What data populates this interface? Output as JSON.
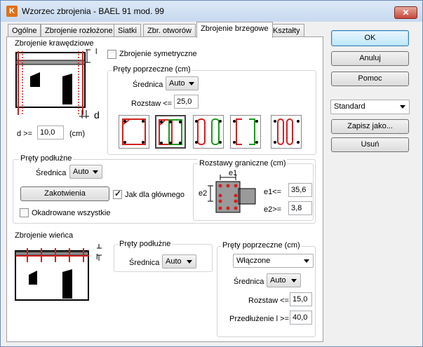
{
  "window": {
    "title": "Wzorzec zbrojenia - BAEL 91 mod. 99",
    "app_icon": "K",
    "close_symbol": "✕"
  },
  "tabs": [
    "Ogólne",
    "Zbrojenie rozłożone",
    "Siatki",
    "Zbr. otworów",
    "Zbrojenie brzegowe",
    "Kształty"
  ],
  "edge_reinf": {
    "group_title": "Zbrojenie krawędziowe",
    "symmetric_label": "Zbrojenie symetryczne",
    "symmetric_checked": false,
    "dim_l": "l",
    "dim_d": "d",
    "d_label": "d >=",
    "d_value": "10,0",
    "d_unit": "(cm)",
    "transverse": {
      "title": "Pręty poprzeczne (cm)",
      "diameter_label": "Średnica",
      "diameter_value": "Auto",
      "spacing_label": "Rozstaw <=",
      "spacing_value": "25,0",
      "selected_shape": 2
    }
  },
  "longitudinal": {
    "title": "Pręty podłużne",
    "diameter_label": "Średnica",
    "diameter_value": "Auto",
    "anchor_button": "Zakotwienia",
    "main_like_label": "Jak dla głównego",
    "main_like_checked": true,
    "framed_all_label": "Okadrowane wszystkie",
    "framed_all_checked": false
  },
  "boundary_spacing": {
    "title": "Rozstawy graniczne (cm)",
    "e1_top": "e1",
    "e2_side": "e2",
    "e1_label": "e1<=",
    "e1_value": "35,6",
    "e2_label": "e2>=",
    "e2_value": "3,8"
  },
  "ring_beam": {
    "title": "Zbrojenie wieńca",
    "dim_l": "l",
    "long_title": "Pręty podłużne",
    "long_diameter_label": "Średnica",
    "long_diameter_value": "Auto",
    "trans_title": "Pręty poprzeczne (cm)",
    "trans_mode_value": "Włączone",
    "trans_diameter_label": "Średnica",
    "trans_diameter_value": "Auto",
    "trans_spacing_label": "Rozstaw <=",
    "trans_spacing_value": "15,0",
    "extension_label": "Przedłużenie l >=",
    "extension_value": "40,0"
  },
  "side_panel": {
    "ok": "OK",
    "cancel": "Anuluj",
    "help": "Pomoc",
    "preset_value": "Standard",
    "save_as": "Zapisz jako...",
    "delete": "Usuń"
  },
  "colors": {
    "rebar_red": "#d22020",
    "rebar_green": "#1a9a1a",
    "concrete": "#9a9a9a"
  }
}
